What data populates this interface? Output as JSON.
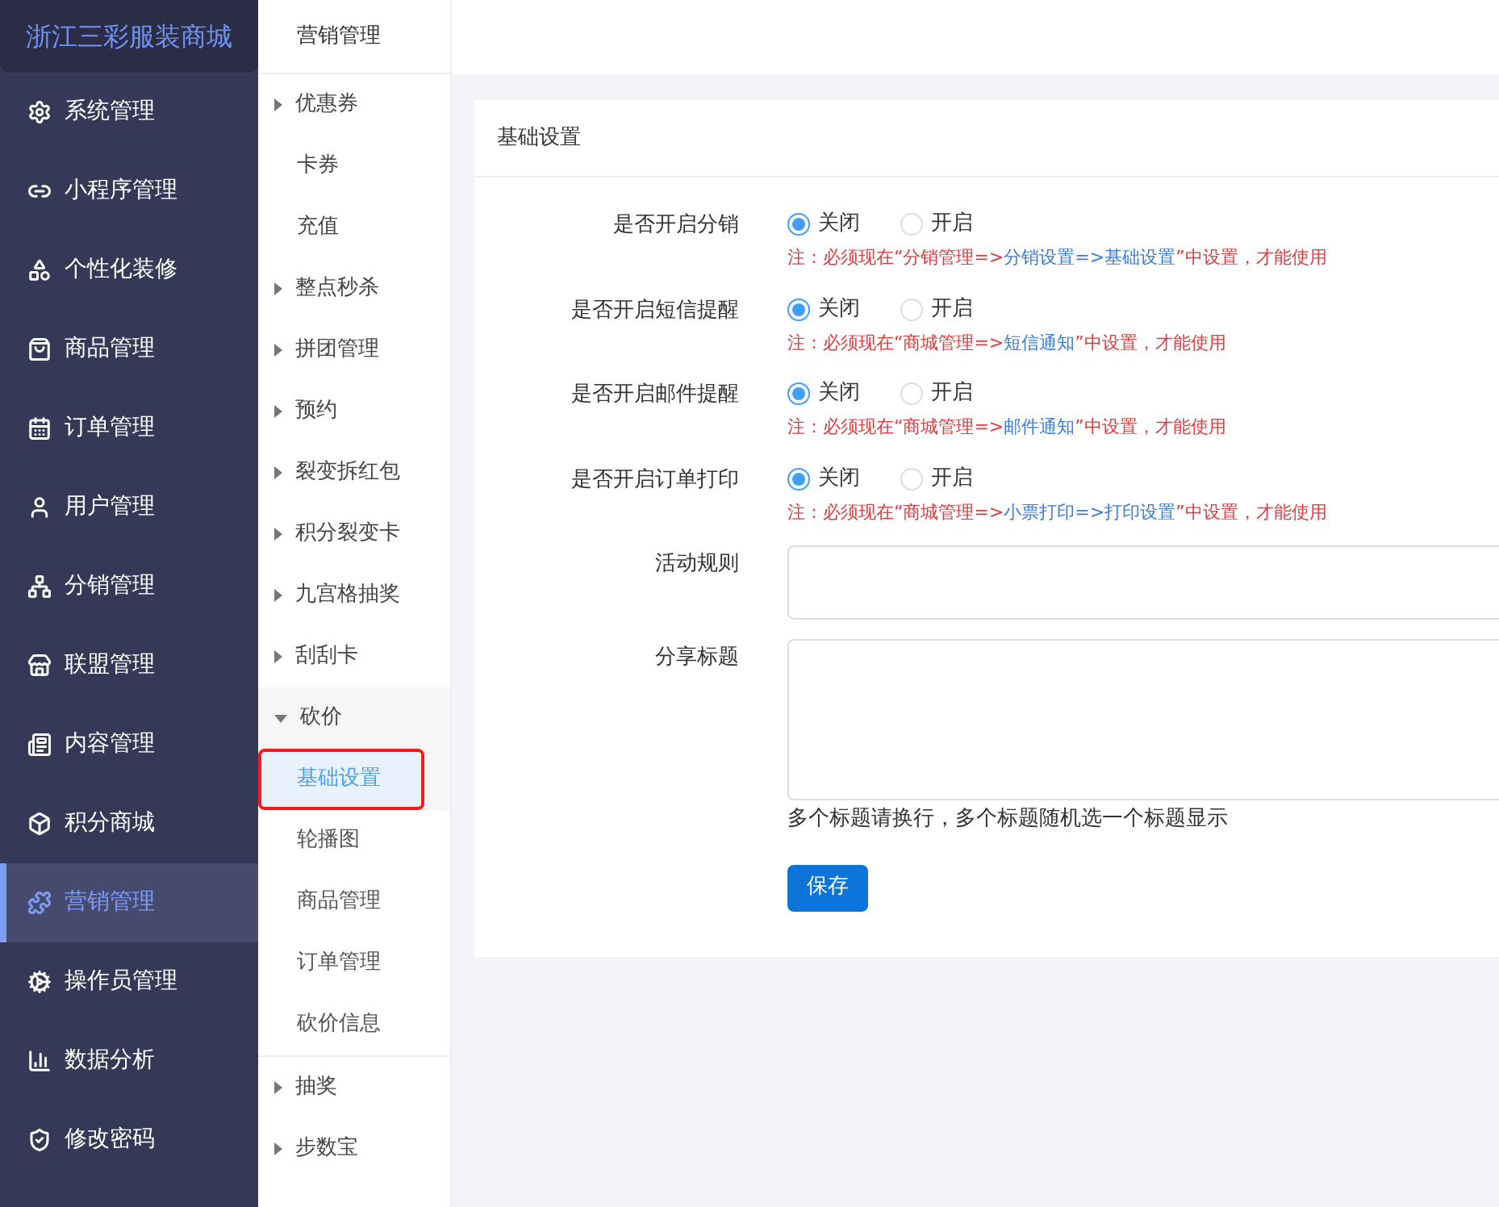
{
  "brand": "浙江三彩服装商城",
  "nav": [
    {
      "label": "系统管理",
      "selected": false
    },
    {
      "label": "小程序管理",
      "selected": false
    },
    {
      "label": "个性化装修",
      "selected": false
    },
    {
      "label": "商品管理",
      "selected": false
    },
    {
      "label": "订单管理",
      "selected": false
    },
    {
      "label": "用户管理",
      "selected": false
    },
    {
      "label": "分销管理",
      "selected": false
    },
    {
      "label": "联盟管理",
      "selected": false
    },
    {
      "label": "内容管理",
      "selected": false
    },
    {
      "label": "积分商城",
      "selected": false
    },
    {
      "label": "营销管理",
      "selected": true
    },
    {
      "label": "操作员管理",
      "selected": false
    },
    {
      "label": "数据分析",
      "selected": false
    },
    {
      "label": "修改密码",
      "selected": false
    }
  ],
  "submenu": {
    "title": "营销管理",
    "items": [
      {
        "label": "优惠券",
        "kind": "group",
        "expanded": false
      },
      {
        "label": "卡券",
        "kind": "leaf",
        "selected": false
      },
      {
        "label": "充值",
        "kind": "leaf",
        "selected": false
      },
      {
        "label": "整点秒杀",
        "kind": "group",
        "expanded": false
      },
      {
        "label": "拼团管理",
        "kind": "group",
        "expanded": false
      },
      {
        "label": "预约",
        "kind": "group",
        "expanded": false
      },
      {
        "label": "裂变拆红包",
        "kind": "group",
        "expanded": false
      },
      {
        "label": "积分裂变卡",
        "kind": "group",
        "expanded": false
      },
      {
        "label": "九宫格抽奖",
        "kind": "group",
        "expanded": false
      },
      {
        "label": "刮刮卡",
        "kind": "group",
        "expanded": false
      },
      {
        "label": "砍价",
        "kind": "group",
        "expanded": true,
        "children": [
          {
            "label": "基础设置",
            "selected": true
          },
          {
            "label": "轮播图",
            "selected": false
          },
          {
            "label": "商品管理",
            "selected": false
          },
          {
            "label": "订单管理",
            "selected": false
          },
          {
            "label": "砍价信息",
            "selected": false
          }
        ]
      },
      {
        "label": "抽奖",
        "kind": "group",
        "expanded": false
      },
      {
        "label": "步数宝",
        "kind": "group",
        "expanded": false
      }
    ]
  },
  "card": {
    "title": "基础设置",
    "fields": [
      {
        "kind": "radio",
        "label": "是否开启分销",
        "options": [
          {
            "label": "关闭",
            "selected": true
          },
          {
            "label": "开启",
            "selected": false
          }
        ],
        "note": [
          {
            "text": "注：必须现在“分销管理=>",
            "kind": "warn"
          },
          {
            "text": "分销设置=>基础设置",
            "kind": "path"
          },
          {
            "text": "”中设置，才能使用",
            "kind": "warn"
          }
        ]
      },
      {
        "kind": "radio",
        "label": "是否开启短信提醒",
        "options": [
          {
            "label": "关闭",
            "selected": true
          },
          {
            "label": "开启",
            "selected": false
          }
        ],
        "note": [
          {
            "text": "注：必须现在“商城管理=>",
            "kind": "warn"
          },
          {
            "text": "短信通知",
            "kind": "path"
          },
          {
            "text": "”中设置，才能使用",
            "kind": "warn"
          }
        ]
      },
      {
        "kind": "radio",
        "label": "是否开启邮件提醒",
        "options": [
          {
            "label": "关闭",
            "selected": true
          },
          {
            "label": "开启",
            "selected": false
          }
        ],
        "note": [
          {
            "text": "注：必须现在“商城管理=>",
            "kind": "warn"
          },
          {
            "text": "邮件通知",
            "kind": "path"
          },
          {
            "text": "”中设置，才能使用",
            "kind": "warn"
          }
        ]
      },
      {
        "kind": "radio",
        "label": "是否开启订单打印",
        "options": [
          {
            "label": "关闭",
            "selected": true
          },
          {
            "label": "开启",
            "selected": false
          }
        ],
        "note": [
          {
            "text": "注：必须现在“商城管理=>",
            "kind": "warn"
          },
          {
            "text": "小票打印=>打印设置",
            "kind": "path"
          },
          {
            "text": "”中设置，才能使用",
            "kind": "warn"
          }
        ]
      },
      {
        "kind": "textbox",
        "label": "活动规则"
      },
      {
        "kind": "textarea",
        "label": "分享标题",
        "hint": "多个标题请换行，多个标题随机选一个标题显示"
      }
    ],
    "save": "保存"
  }
}
